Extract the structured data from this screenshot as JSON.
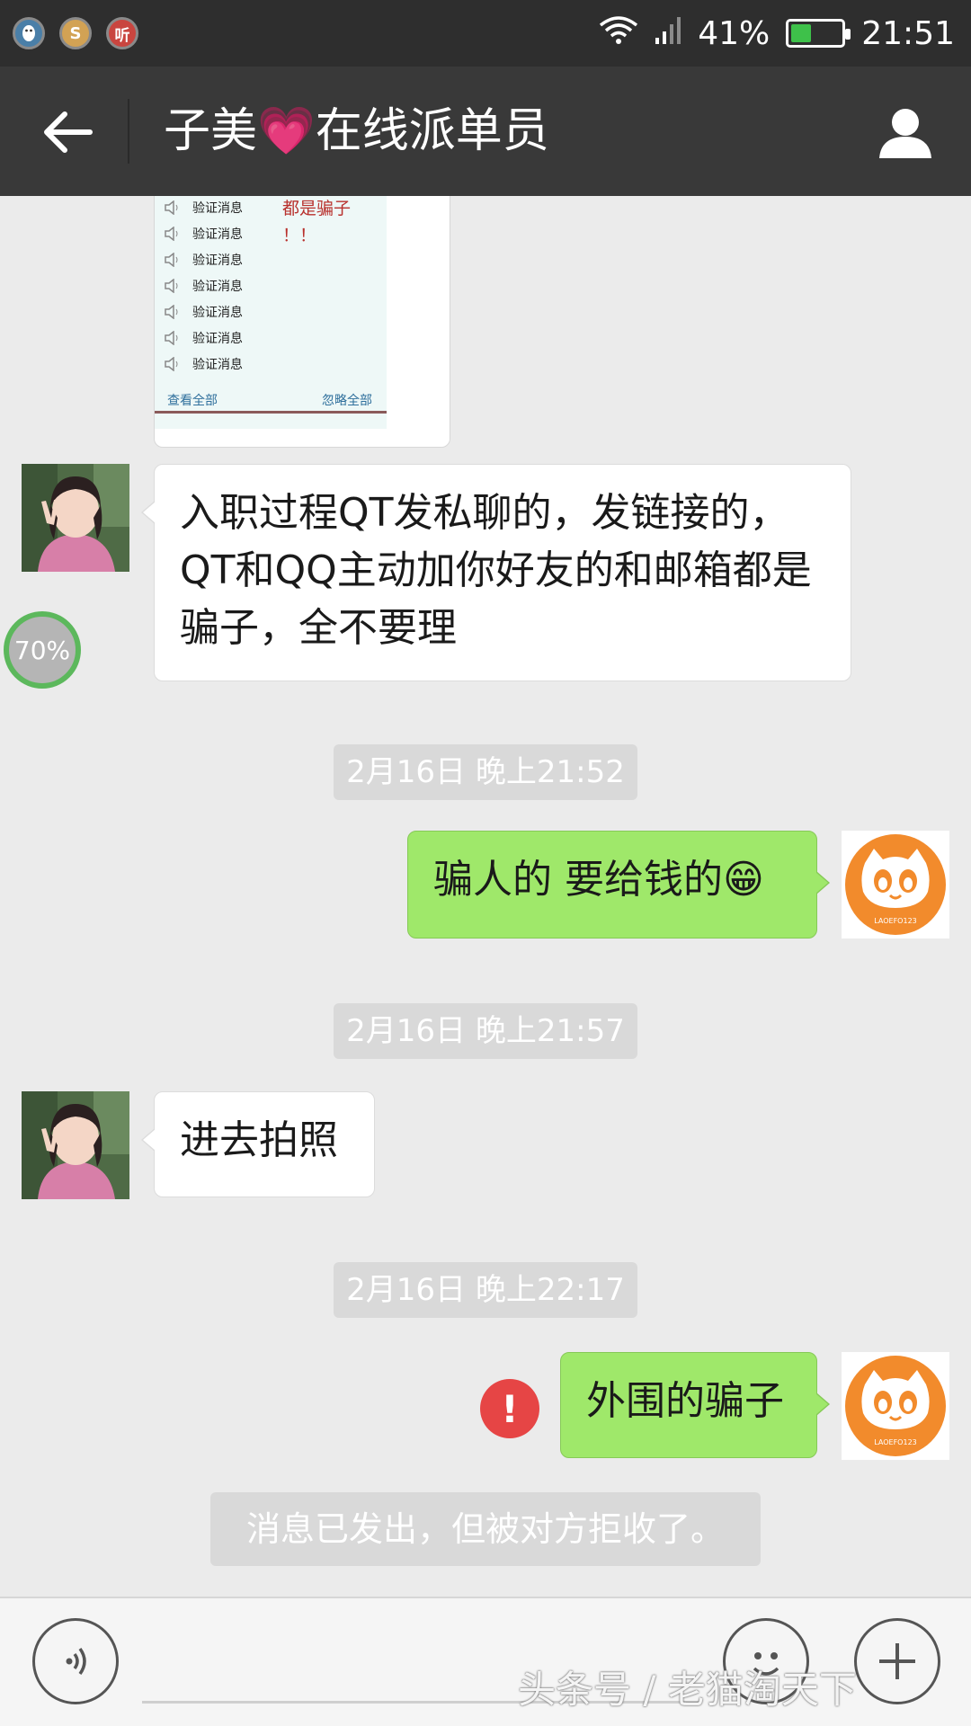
{
  "status_bar": {
    "battery_percent": "41%",
    "battery_level": 0.41,
    "time": "21:51",
    "notification_icons": [
      "qq-icon",
      "s-app-icon",
      "listen-app-icon"
    ]
  },
  "header": {
    "title": "子美💗在线派单员"
  },
  "chat": {
    "image_message": {
      "rows": [
        "验证消息",
        "验证消息",
        "验证消息",
        "验证消息",
        "验证消息",
        "验证消息",
        "验证消息"
      ],
      "warning_lines": [
        "都是骗子",
        "！！"
      ],
      "view_all": "查看全部",
      "ignore_all": "忽略全部"
    },
    "msg1": {
      "text": "入职过程QT发私聊的，发链接的，QT和QQ主动加你好友的和邮箱都是骗子，全不要理"
    },
    "voice_progress": "70%",
    "ts1": "2月16日 晚上21:52",
    "msg2": {
      "text": "骗人的 要给钱的😁"
    },
    "ts2": "2月16日 晚上21:57",
    "msg3": {
      "text": "进去拍照"
    },
    "ts3": "2月16日 晚上22:17",
    "msg4": {
      "text": "外围的骗子"
    },
    "send_failed_icon": "!",
    "rejected_notice": "消息已发出，但被对方拒收了。",
    "cat_avatar_text": "LAOEFO123"
  },
  "watermark": "头条号 / 老猫淘天下",
  "colors": {
    "header_bg": "#393939",
    "sent_bubble": "#9fe86a",
    "error_red": "#e64545",
    "cat_orange": "#f28b2c"
  }
}
